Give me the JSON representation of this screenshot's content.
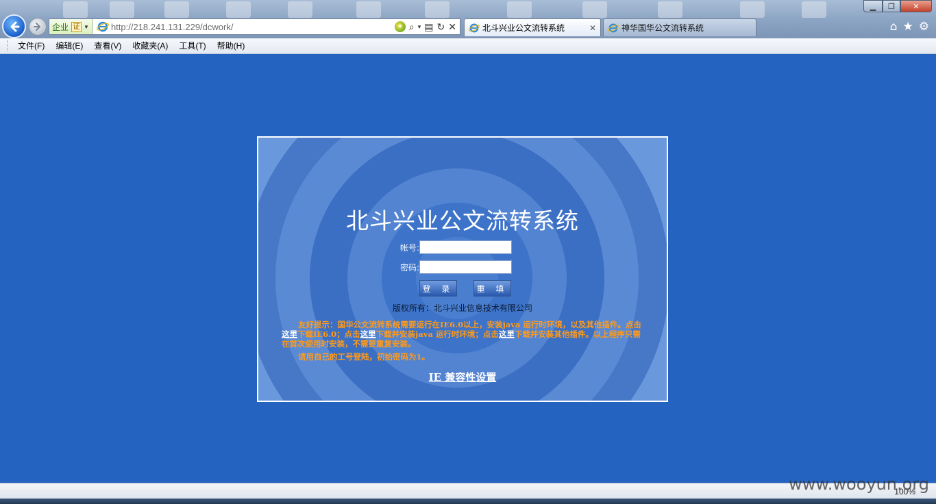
{
  "browser": {
    "address": {
      "cert_org": "企业",
      "cert_badge": "证",
      "url": "http://218.241.131.229/dcwork/"
    },
    "tabs": [
      {
        "title": "北斗兴业公文流转系统",
        "active": true
      },
      {
        "title": "神华国华公文流转系统",
        "active": false
      }
    ],
    "menu": [
      "文件(F)",
      "编辑(E)",
      "查看(V)",
      "收藏夹(A)",
      "工具(T)",
      "帮助(H)"
    ],
    "zoom": "100%"
  },
  "login": {
    "title": "北斗兴业公文流转系统",
    "account_label": "帐号:",
    "password_label": "密码:",
    "login_button": "登 录",
    "reset_button": "重 填",
    "copyright": "版权所有：北斗兴业信息技术有限公司",
    "notice_prefix": "友好提示：国华公文流转系统需要运行在IE6.0以上，安装java 运行时环境，以及其他插件。点击",
    "link_here_1": "这里",
    "notice_mid1": "下载IE6.0；点击",
    "link_here_2": "这里",
    "notice_mid2": "下载并安装java 运行时环境；点击",
    "link_here_3": "这里",
    "notice_suffix": "下载并安装其他插件。以上程序只需在首次使用时安装，不需要重复安装。",
    "notice_password": "请用自己的工号登陆，初始密码为1。",
    "compat_link": "IE 兼容性设置"
  },
  "watermark": "www.wooyun.org",
  "colors": {
    "page_background": "#2563c0",
    "notice_orange": "#ff9a1a"
  }
}
